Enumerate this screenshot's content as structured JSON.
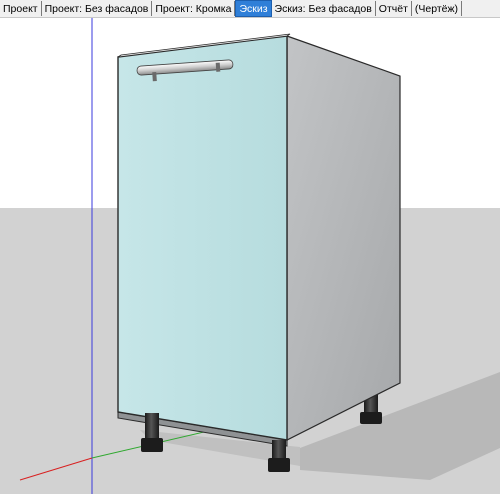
{
  "tabs": [
    {
      "label": "Проект",
      "active": false
    },
    {
      "label": "Проект: Без фасадов",
      "active": false
    },
    {
      "label": "Проект: Кромка",
      "active": false
    },
    {
      "label": "Эскиз",
      "active": true
    },
    {
      "label": "Эскиз: Без фасадов",
      "active": false
    },
    {
      "label": "Отчёт",
      "active": false
    },
    {
      "label": "(Чертёж)",
      "active": false
    }
  ],
  "colors": {
    "sky": "#ffffff",
    "ground": "#d2d2d2",
    "door_face": "#bfe2e4",
    "side_face": "#b4b6b8",
    "active_tab": "#2f7fd8"
  }
}
